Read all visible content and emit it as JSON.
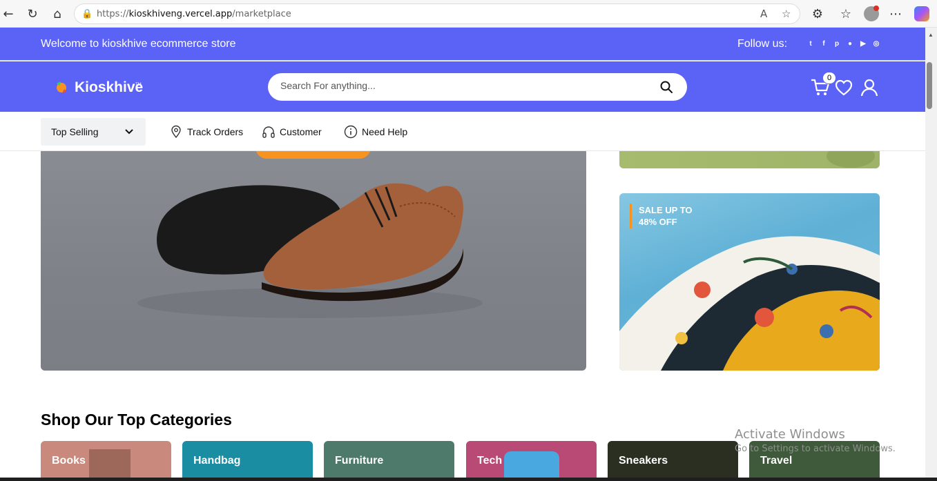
{
  "browser": {
    "url_prefix": "https://",
    "url_host": "kioskhiveng.vercel.app",
    "url_path": "/marketplace"
  },
  "topbar": {
    "welcome": "Welcome to kioskhive ecommerce store",
    "follow_label": "Follow us:",
    "socials": [
      "twitter-icon",
      "facebook-icon",
      "pinterest-icon",
      "reddit-icon",
      "youtube-icon",
      "instagram-icon"
    ]
  },
  "header": {
    "logo_text": "Kioskhive",
    "logo_tm": "TM",
    "search_placeholder": "Search For anything...",
    "cart_count": "0"
  },
  "nav": {
    "dropdown_label": "Top Selling",
    "items": [
      {
        "label": "Track Orders",
        "icon": "location-pin-icon"
      },
      {
        "label": "Customer",
        "icon": "headphones-icon"
      },
      {
        "label": "Need Help",
        "icon": "info-icon"
      }
    ]
  },
  "promo": {
    "sale_line1": "SALE UP TO",
    "sale_line2": "48% OFF"
  },
  "categories_section": {
    "title": "Shop Our Top Categories",
    "items": [
      {
        "label": "Books",
        "color": "#c98a7d"
      },
      {
        "label": "Handbag",
        "color": "#1a8da3"
      },
      {
        "label": "Furniture",
        "color": "#4d7a6b"
      },
      {
        "label": "Tech",
        "color": "#b84a75"
      },
      {
        "label": "Sneakers",
        "color": "#2a2f22"
      },
      {
        "label": "Travel",
        "color": "#3f5a3a"
      }
    ]
  },
  "os_watermark": {
    "line1": "Activate Windows",
    "line2": "Go to Settings to activate Windows."
  },
  "colors": {
    "brand": "#5b63f6",
    "accent": "#f7931e"
  }
}
